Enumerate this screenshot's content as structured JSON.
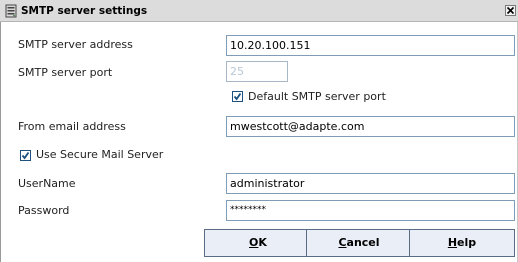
{
  "window": {
    "title": "SMTP server settings",
    "close_symbol": "×"
  },
  "form": {
    "smtp_address": {
      "label": "SMTP server address",
      "value": "10.20.100.151"
    },
    "smtp_port": {
      "label": "SMTP server port",
      "value": "25",
      "disabled": true
    },
    "default_port": {
      "label": "Default SMTP server port",
      "checked": true
    },
    "from_email": {
      "label": "From email address",
      "value": "mwestcott@adapte.com"
    },
    "secure_mail": {
      "label": "Use Secure Mail Server",
      "checked": true
    },
    "username": {
      "label": "UserName",
      "value": "administrator"
    },
    "password": {
      "label": "Password",
      "value": "********"
    }
  },
  "buttons": {
    "ok": {
      "mnemonic": "O",
      "rest": "K"
    },
    "cancel": {
      "mnemonic": "C",
      "rest": "ancel"
    },
    "help": {
      "mnemonic": "H",
      "rest": "elp"
    }
  },
  "icons": {
    "title": "smtp-server-icon",
    "close": "close-icon",
    "check": "check-icon"
  },
  "colors": {
    "field_border": "#7f9db9",
    "button_face": "#e9eef7",
    "check_mark": "#1c4f7c"
  }
}
